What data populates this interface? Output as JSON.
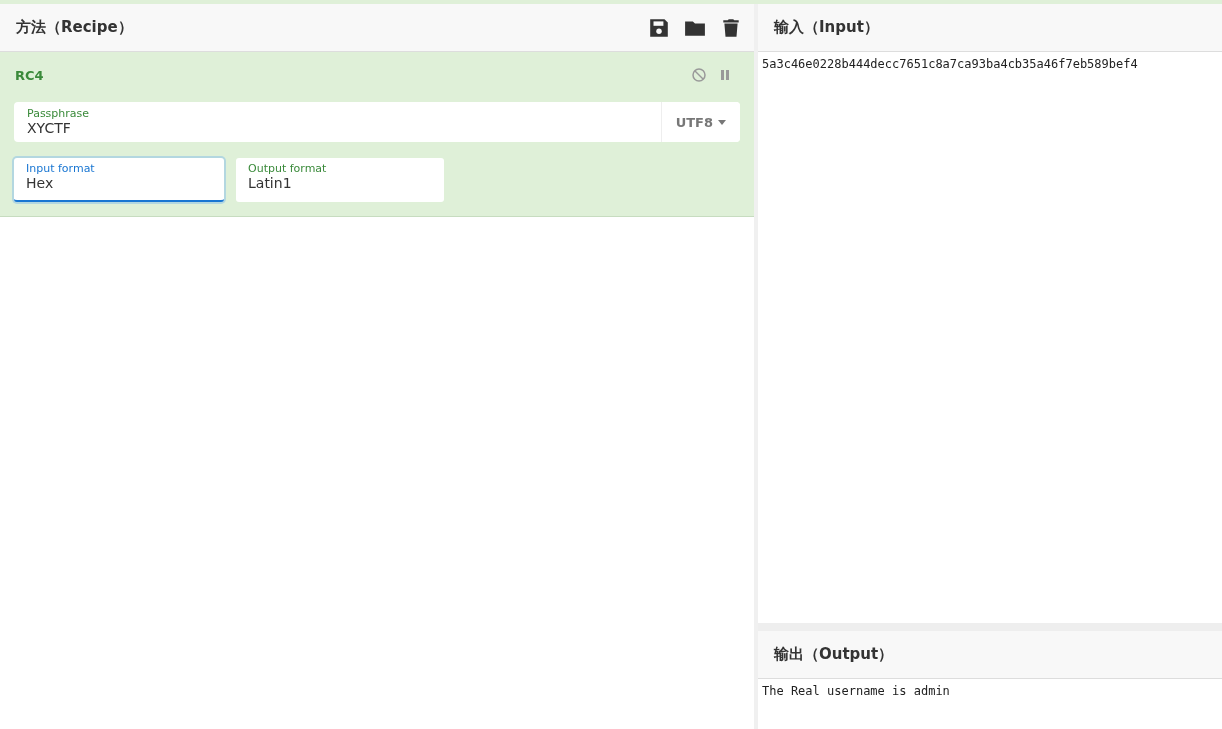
{
  "recipe": {
    "title": "方法（Recipe）",
    "operation": {
      "name": "RC4",
      "disabled": false,
      "paused": false,
      "passphrase": {
        "label": "Passphrase",
        "value": "XYCTF",
        "encoding": "UTF8"
      },
      "fields": [
        {
          "label": "Input format",
          "value": "Hex",
          "focused": true
        },
        {
          "label": "Output format",
          "value": "Latin1",
          "focused": false
        }
      ]
    }
  },
  "input": {
    "title": "输入（Input）",
    "text": "5a3c46e0228b444decc7651c8a7ca93ba4cb35a46f7eb589bef4"
  },
  "output": {
    "title": "输出（Output）",
    "text": "The Real username is admin"
  }
}
